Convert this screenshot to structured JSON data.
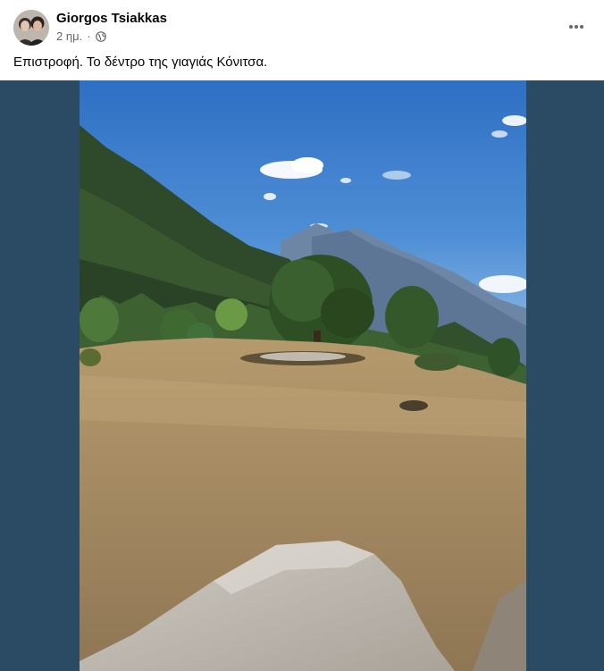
{
  "post": {
    "author": "Giorgos Tsiakkas",
    "time": "2 ημ.",
    "separator": "·",
    "audience_icon": "globe-icon",
    "more_icon": "more-options-icon",
    "caption": "Επιστροφή. Το δέντρο της γιαγιάς Κόνιτσα."
  },
  "colors": {
    "media_background": "#2b4a63",
    "meta_text": "#65676b",
    "text": "#050505"
  }
}
